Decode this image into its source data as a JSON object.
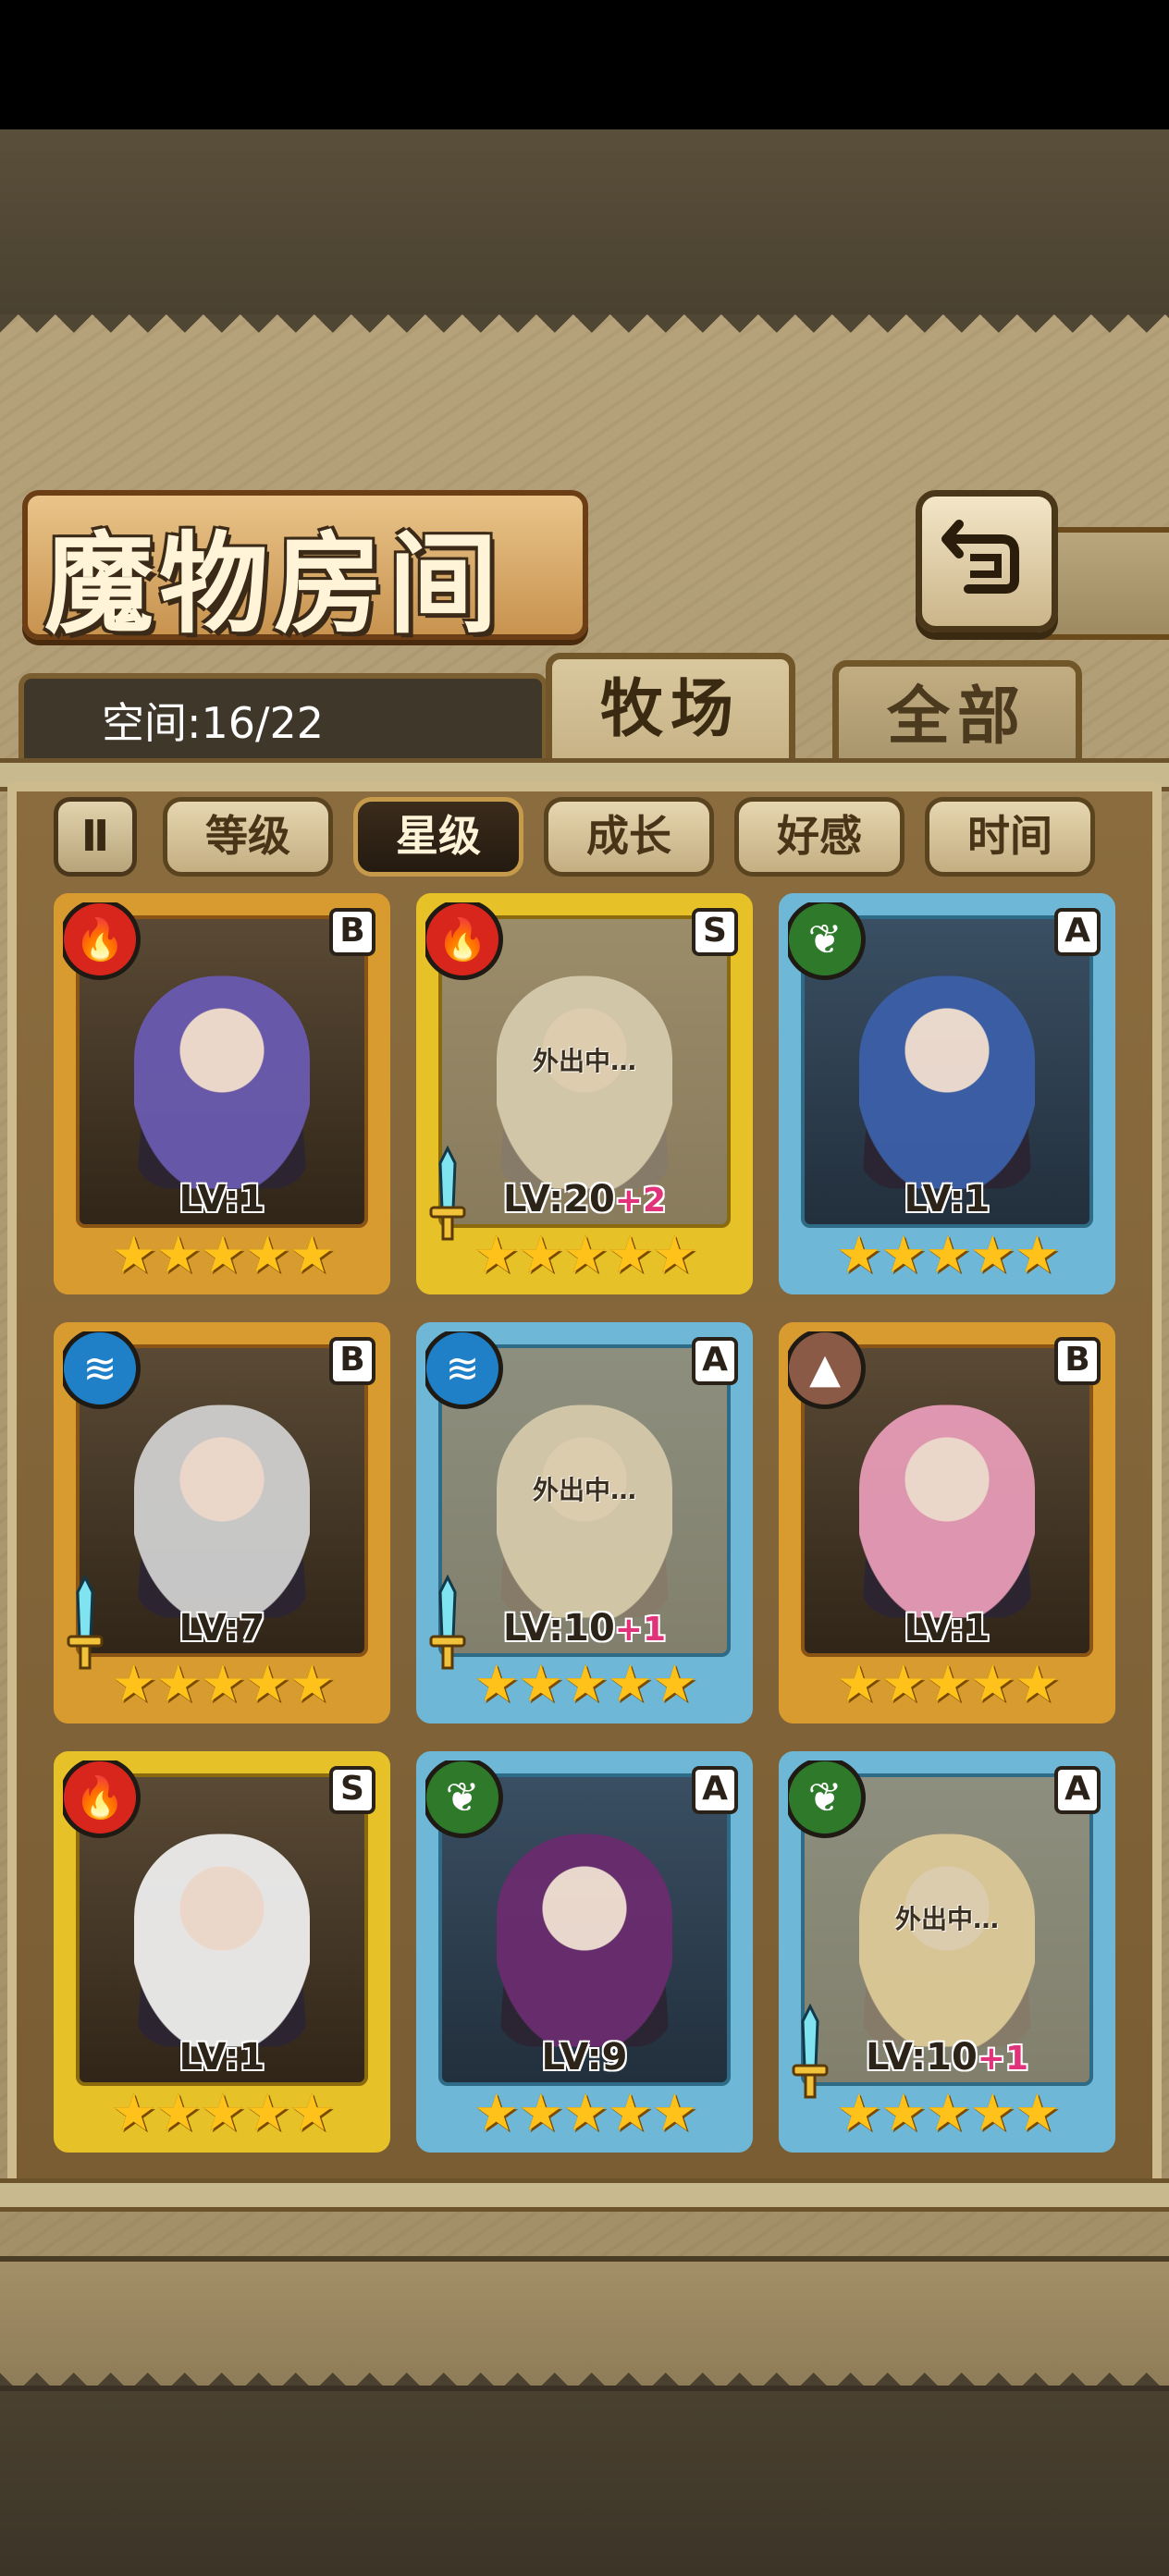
{
  "title": "魔物房间",
  "space": {
    "label": "空间:16/22"
  },
  "tabs": [
    {
      "label": "牧场",
      "active": true
    },
    {
      "label": "全部",
      "active": false
    }
  ],
  "sort": {
    "toggle_label": "Ⅱ",
    "buttons": [
      {
        "label": "等级",
        "active": false
      },
      {
        "label": "星级",
        "active": true
      },
      {
        "label": "成长",
        "active": false
      },
      {
        "label": "好感",
        "active": false
      },
      {
        "label": "时间",
        "active": false
      }
    ]
  },
  "away_label": "外出中…",
  "monsters": [
    {
      "element": "fire",
      "rank": "B",
      "level": "LV:1",
      "plus": "",
      "stars": 5,
      "away": false,
      "equipped": false
    },
    {
      "element": "fire",
      "rank": "S",
      "level": "LV:20",
      "plus": "+2",
      "stars": 5,
      "away": true,
      "equipped": true
    },
    {
      "element": "leaf",
      "rank": "A",
      "level": "LV:1",
      "plus": "",
      "stars": 5,
      "away": false,
      "equipped": false
    },
    {
      "element": "water",
      "rank": "B",
      "level": "LV:7",
      "plus": "",
      "stars": 5,
      "away": false,
      "equipped": true
    },
    {
      "element": "water",
      "rank": "A",
      "level": "LV:10",
      "plus": "+1",
      "stars": 5,
      "away": true,
      "equipped": true
    },
    {
      "element": "earth",
      "rank": "B",
      "level": "LV:1",
      "plus": "",
      "stars": 5,
      "away": false,
      "equipped": false
    },
    {
      "element": "fire",
      "rank": "S",
      "level": "LV:1",
      "plus": "",
      "stars": 5,
      "away": false,
      "equipped": false
    },
    {
      "element": "leaf",
      "rank": "A",
      "level": "LV:9",
      "plus": "",
      "stars": 5,
      "away": false,
      "equipped": false
    },
    {
      "element": "leaf",
      "rank": "A",
      "level": "LV:10",
      "plus": "+1",
      "stars": 5,
      "away": true,
      "equipped": true
    }
  ],
  "element_colors": {
    "fire": "#d8261c",
    "leaf": "#2f7a2a",
    "water": "#1f7fc7",
    "earth": "#8a5a46"
  }
}
